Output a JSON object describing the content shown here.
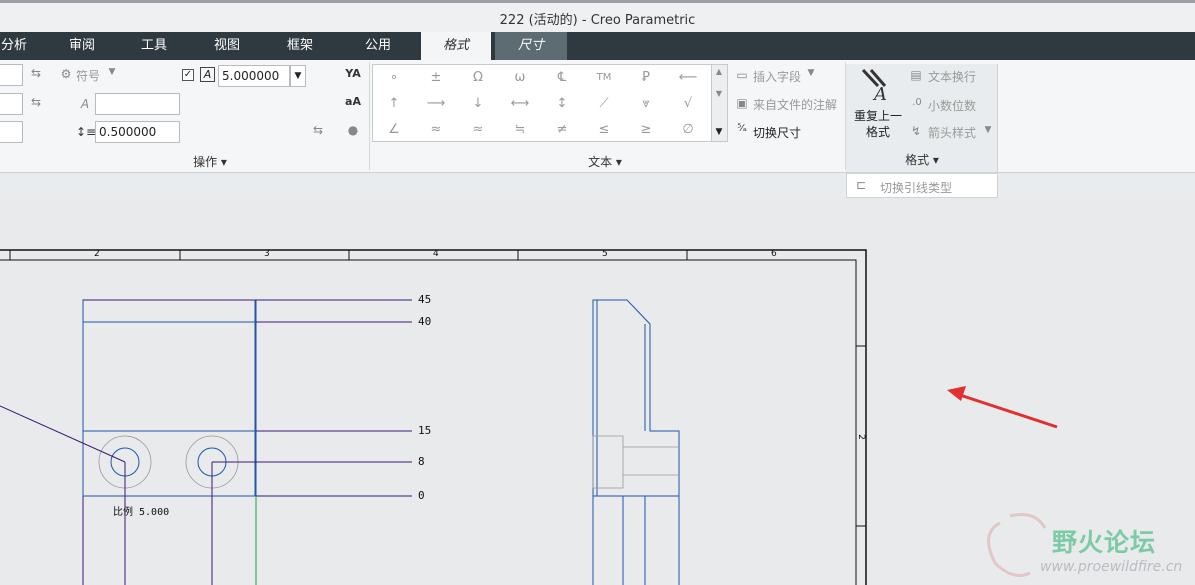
{
  "window": {
    "title": "222 (活动的) - Creo Parametric"
  },
  "tabs": [
    {
      "label": "分析"
    },
    {
      "label": "审阅"
    },
    {
      "label": "工具"
    },
    {
      "label": "视图"
    },
    {
      "label": "框架"
    },
    {
      "label": "公用"
    },
    {
      "label": "格式"
    },
    {
      "label": "尺寸"
    }
  ],
  "ribbon": {
    "operations": {
      "symbol_label": "符号",
      "height_value": "5.000000",
      "spacing_value": "0.500000",
      "group_label": "操作"
    },
    "text_group": {
      "symbols": [
        "∘",
        "±",
        "Ω",
        "ω",
        "℄",
        "TM",
        "Ꝑ",
        "⟵",
        "↑",
        "⟶",
        "↓",
        "⟷",
        "↕",
        "⟋",
        "⩔",
        "√",
        "∠",
        "≈",
        "≈",
        "≒",
        "≠",
        "≤",
        "≥",
        "∅"
      ],
      "insert_field": "插入字段",
      "from_file_note": "来自文件的注解",
      "toggle_dimension": "切换尺寸",
      "group_label": "文本"
    },
    "format_group": {
      "repeat_last_line1": "重复上一",
      "repeat_last_line2": "格式",
      "text_wrap": "文本换行",
      "decimals": "小数位数",
      "arrow_style": "箭头样式",
      "group_label": "格式"
    },
    "dropdown": {
      "toggle_leader_type": "切换引线类型"
    }
  },
  "drawing": {
    "ruler_numbers": [
      "2",
      "3",
      "4",
      "5",
      "6"
    ],
    "side_ruler_number": "2",
    "dim_labels": [
      "45",
      "40",
      "15",
      "8",
      "0"
    ],
    "scale_note": "比例 5.000"
  },
  "watermark": {
    "text": "野火论坛",
    "url": "www.proewildfire.cn"
  },
  "colors": {
    "tabbar": "#2f3a40",
    "drawing_blue": "#1f56a8",
    "dim_purple": "#3c1a78",
    "annotation_red": "#e03030",
    "watermark_green": "#7dcaa6"
  }
}
